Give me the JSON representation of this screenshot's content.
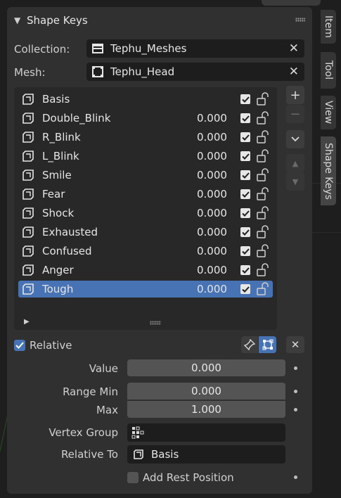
{
  "panel": {
    "title": "Shape Keys",
    "collection_label": "Collection:",
    "collection_value": "Tephu_Meshes",
    "mesh_label": "Mesh:",
    "mesh_value": "Tephu_Head"
  },
  "shape_keys": [
    {
      "name": "Basis",
      "value": "",
      "enabled": true,
      "selected": false
    },
    {
      "name": "Double_Blink",
      "value": "0.000",
      "enabled": true,
      "selected": false
    },
    {
      "name": "R_Blink",
      "value": "0.000",
      "enabled": true,
      "selected": false
    },
    {
      "name": "L_Blink",
      "value": "0.000",
      "enabled": true,
      "selected": false
    },
    {
      "name": "Smile",
      "value": "0.000",
      "enabled": true,
      "selected": false
    },
    {
      "name": "Fear",
      "value": "0.000",
      "enabled": true,
      "selected": false
    },
    {
      "name": "Shock",
      "value": "0.000",
      "enabled": true,
      "selected": false
    },
    {
      "name": "Exhausted",
      "value": "0.000",
      "enabled": true,
      "selected": false
    },
    {
      "name": "Confused",
      "value": "0.000",
      "enabled": true,
      "selected": false
    },
    {
      "name": "Anger",
      "value": "0.000",
      "enabled": true,
      "selected": false
    },
    {
      "name": "Tough",
      "value": "0.000",
      "enabled": true,
      "selected": true
    }
  ],
  "side_buttons": {
    "add": "+",
    "remove": "−",
    "specials": "⌄",
    "move_up": "▲",
    "move_down": "▼"
  },
  "relative": {
    "label": "Relative",
    "checked": true
  },
  "props": {
    "value_label": "Value",
    "value": "0.000",
    "range_min_label": "Range Min",
    "range_min": "0.000",
    "max_label": "Max",
    "max": "1.000",
    "vertex_group_label": "Vertex Group",
    "vertex_group": "",
    "relative_to_label": "Relative To",
    "relative_to": "Basis",
    "add_rest_label": "Add Rest Position",
    "add_rest_checked": false
  },
  "tabs": [
    "Item",
    "Tool",
    "View",
    "Shape Keys"
  ],
  "active_tab": "Shape Keys",
  "colors": {
    "panel": "#303030",
    "selection": "#4772b3",
    "field": "#1d1d1d"
  }
}
